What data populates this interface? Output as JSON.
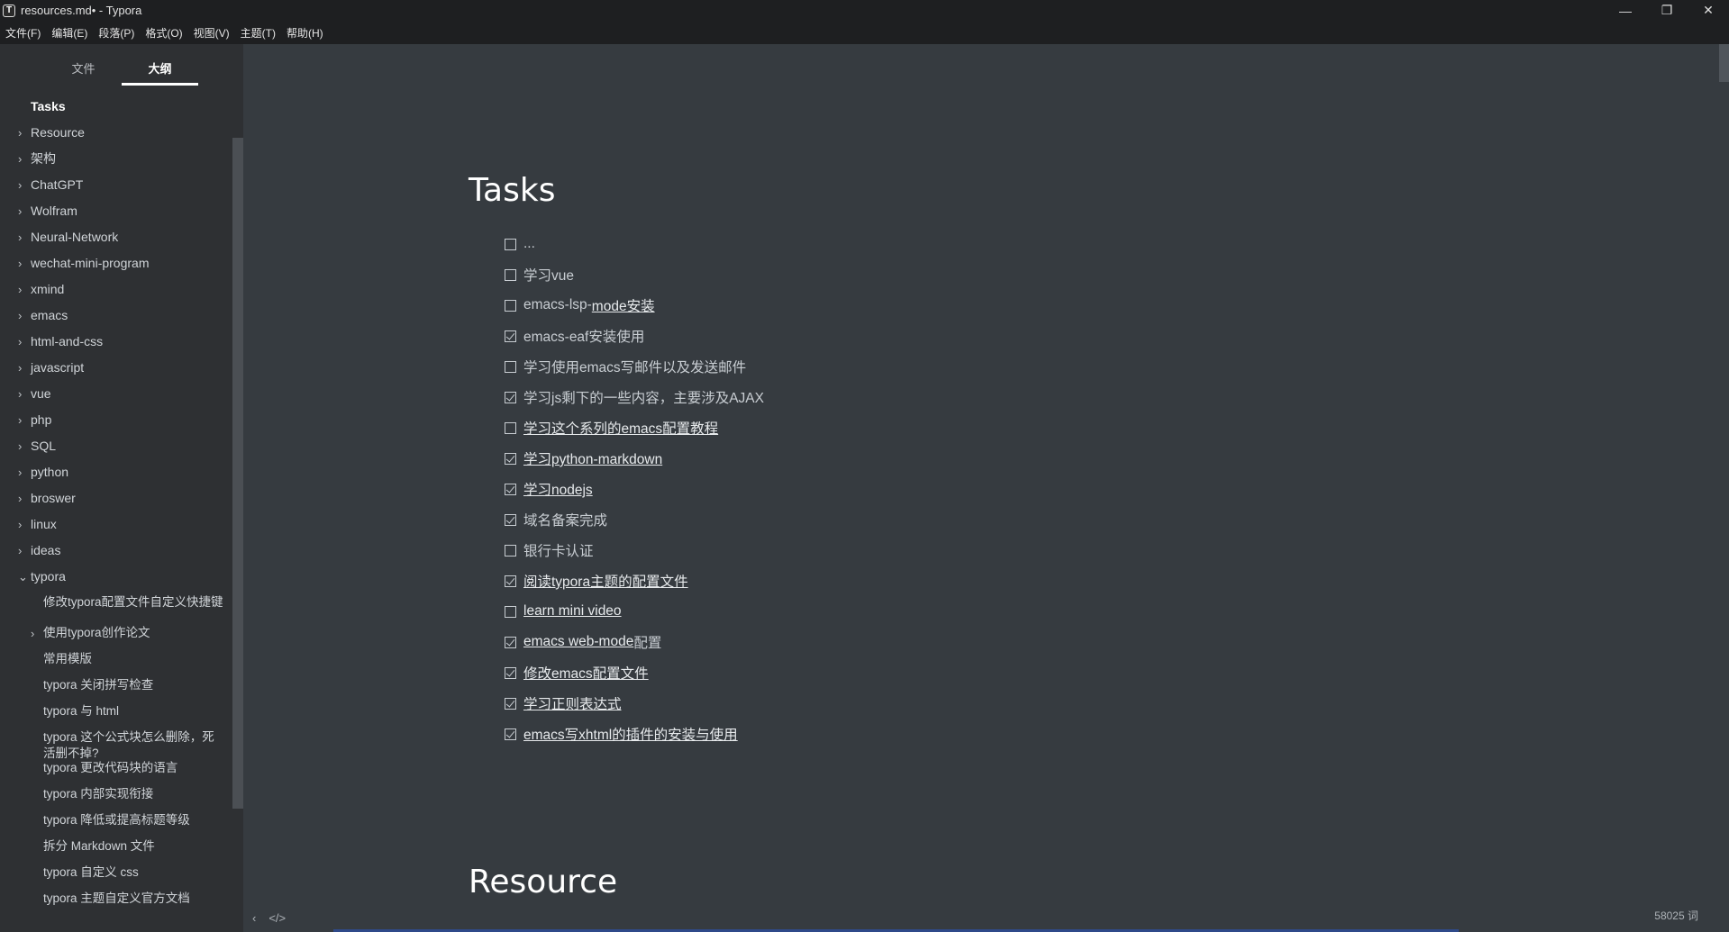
{
  "window": {
    "title": "resources.md• - Typora",
    "app_icon": "T",
    "controls": [
      "minimize-icon",
      "restore-icon",
      "close-icon"
    ]
  },
  "menu": [
    "文件(F)",
    "编辑(E)",
    "段落(P)",
    "格式(O)",
    "视图(V)",
    "主题(T)",
    "帮助(H)"
  ],
  "sidebar": {
    "tabs": [
      {
        "label": "文件",
        "active": false
      },
      {
        "label": "大纲",
        "active": true
      }
    ],
    "outline": [
      {
        "label": "Tasks",
        "bold": true,
        "arrow": ""
      },
      {
        "label": "Resource",
        "arrow": "›"
      },
      {
        "label": "架构",
        "arrow": "›"
      },
      {
        "label": "ChatGPT",
        "arrow": "›"
      },
      {
        "label": "Wolfram",
        "arrow": "›"
      },
      {
        "label": "Neural-Network",
        "arrow": "›"
      },
      {
        "label": "wechat-mini-program",
        "arrow": "›"
      },
      {
        "label": "xmind",
        "arrow": "›"
      },
      {
        "label": "emacs",
        "arrow": "›"
      },
      {
        "label": "html-and-css",
        "arrow": "›"
      },
      {
        "label": "javascript",
        "arrow": "›"
      },
      {
        "label": "vue",
        "arrow": "›"
      },
      {
        "label": "php",
        "arrow": "›"
      },
      {
        "label": "SQL",
        "arrow": "›"
      },
      {
        "label": "python",
        "arrow": "›"
      },
      {
        "label": "broswer",
        "arrow": "›"
      },
      {
        "label": "linux",
        "arrow": "›"
      },
      {
        "label": "ideas",
        "arrow": "›"
      },
      {
        "label": "typora",
        "arrow": "⌄"
      },
      {
        "label": "修改typora配置文件自定义快捷键",
        "sub": true,
        "arrow": ""
      },
      {
        "label": "使用typora创作论文",
        "sub": true,
        "arrow": "›"
      },
      {
        "label": "常用模版",
        "sub": true,
        "arrow": ""
      },
      {
        "label": "typora 关闭拼写检查",
        "sub": true,
        "arrow": ""
      },
      {
        "label": "typora 与 html",
        "sub": true,
        "arrow": ""
      },
      {
        "label": "typora 这个公式块怎么删除，死活删不掉?",
        "sub": true,
        "arrow": ""
      },
      {
        "label": "typora 更改代码块的语言",
        "sub": true,
        "arrow": ""
      },
      {
        "label": "typora 内部实现衔接",
        "sub": true,
        "arrow": ""
      },
      {
        "label": "typora 降低或提高标题等级",
        "sub": true,
        "arrow": ""
      },
      {
        "label": "拆分 Markdown 文件",
        "sub": true,
        "arrow": ""
      },
      {
        "label": "typora 自定义 css",
        "sub": true,
        "arrow": ""
      },
      {
        "label": "typora 主题自定义官方文档",
        "sub": true,
        "arrow": ""
      }
    ]
  },
  "editor": {
    "heading1": "Tasks",
    "heading2": "Resource",
    "tasks": [
      {
        "text": "...",
        "checked": false,
        "link": false
      },
      {
        "text": "学习vue",
        "checked": false,
        "link": false
      },
      {
        "text": "emacs-lsp-",
        "link_text": "mode安装",
        "checked": false,
        "link": "partial"
      },
      {
        "text": "emacs-eaf安装使用",
        "checked": true,
        "link": false
      },
      {
        "text": "学习使用emacs写邮件以及发送邮件",
        "checked": false,
        "link": false
      },
      {
        "text": "学习js剩下的一些内容，主要涉及AJAX",
        "checked": true,
        "link": false
      },
      {
        "text": "学习这个系列的emacs配置教程",
        "checked": false,
        "link": true
      },
      {
        "text": "学习python-markdown",
        "checked": true,
        "link": true
      },
      {
        "text": "学习nodejs",
        "checked": true,
        "link": true
      },
      {
        "text": "域名备案完成",
        "checked": true,
        "link": false
      },
      {
        "text": "银行卡认证",
        "checked": false,
        "link": false
      },
      {
        "text": "阅读typora主题的配置文件",
        "checked": true,
        "link": true
      },
      {
        "text": "learn mini video",
        "checked": false,
        "link": true
      },
      {
        "text": "emacs web-mode",
        "suffix": "配置",
        "checked": true,
        "link": "prefix"
      },
      {
        "text": "修改emacs配置文件",
        "checked": true,
        "link": true
      },
      {
        "text": "学习正则表达式",
        "checked": true,
        "link": true
      },
      {
        "text": "emacs写xhtml的插件的安装与使用",
        "checked": true,
        "link": true
      }
    ],
    "status": {
      "word_count": "58025 词",
      "icons": [
        "chevron-left-icon",
        "source-code-icon"
      ]
    }
  }
}
